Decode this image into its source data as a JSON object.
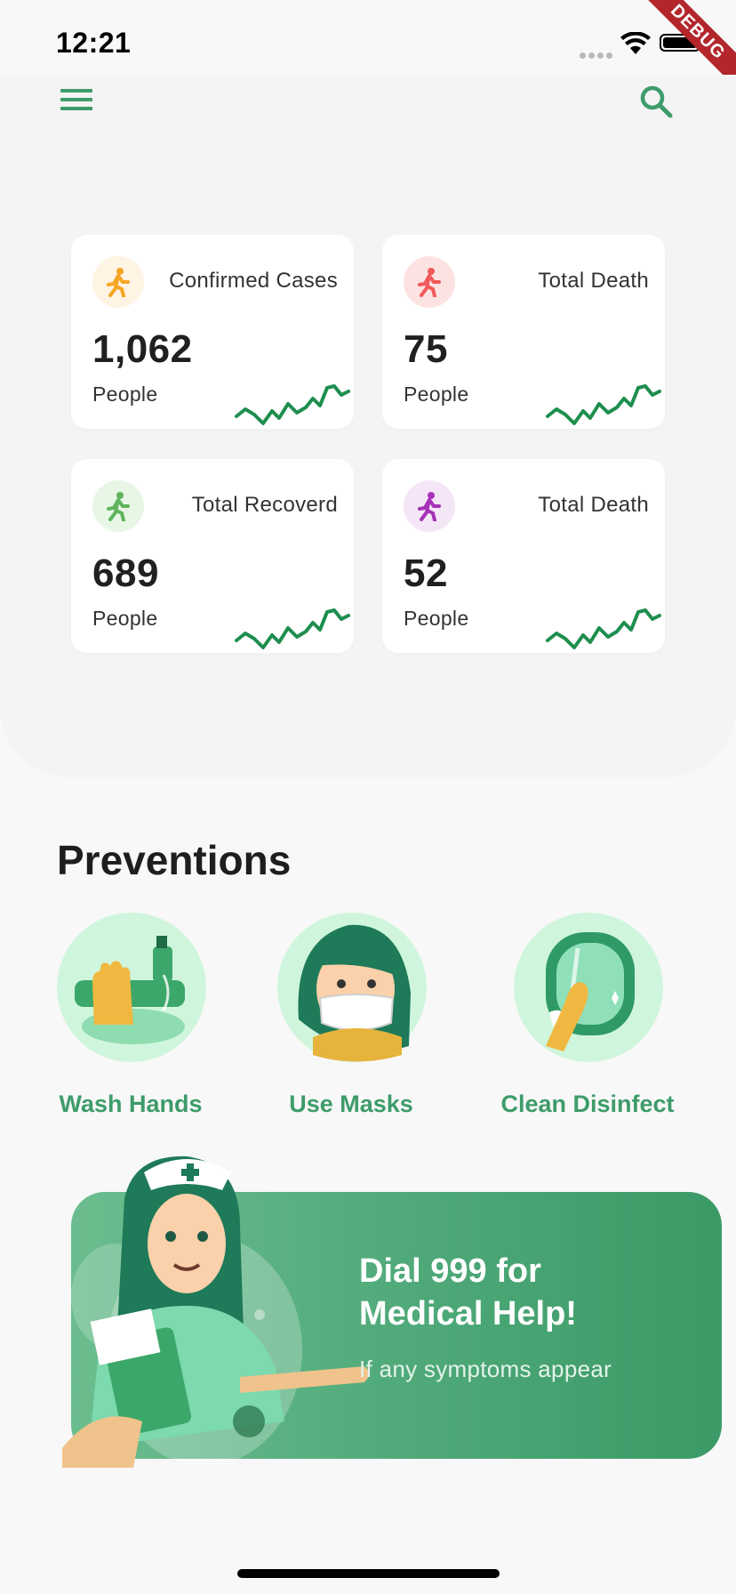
{
  "status": {
    "time": "12:21",
    "debug_label": "DEBUG"
  },
  "header": {
    "menu_icon": "menu-icon",
    "search_icon": "search-icon",
    "accent": "#3e9c6a"
  },
  "stats": [
    {
      "title": "Confirmed Cases",
      "value": "1,062",
      "unit": "People",
      "color": "#f5a623",
      "bg": "#fff3e3",
      "icon": "running-person-icon"
    },
    {
      "title": "Total Death",
      "value": "75",
      "unit": "People",
      "color": "#f05a5a",
      "bg": "#fde2e2",
      "icon": "running-person-icon"
    },
    {
      "title": "Total Recoverd",
      "value": "689",
      "unit": "People",
      "color": "#5fb55e",
      "bg": "#e8f6e6",
      "icon": "running-person-icon"
    },
    {
      "title": "Total Death",
      "value": "52",
      "unit": "People",
      "color": "#a632b8",
      "bg": "#f5e6f7",
      "icon": "running-person-icon"
    }
  ],
  "preventions": {
    "title": "Preventions",
    "items": [
      {
        "label": "Wash Hands",
        "icon": "wash-hands-icon"
      },
      {
        "label": "Use Masks",
        "icon": "mask-icon"
      },
      {
        "label": "Clean Disinfect",
        "icon": "disinfect-icon"
      }
    ]
  },
  "help": {
    "title_line1": "Dial 999 for",
    "title_line2": "Medical Help!",
    "subtitle": "If any symptoms appear",
    "illustration": "nurse-illustration"
  },
  "colors": {
    "spark": "#1e8e4e",
    "banner_start": "#6bbd8e",
    "banner_end": "#3b9a66"
  }
}
